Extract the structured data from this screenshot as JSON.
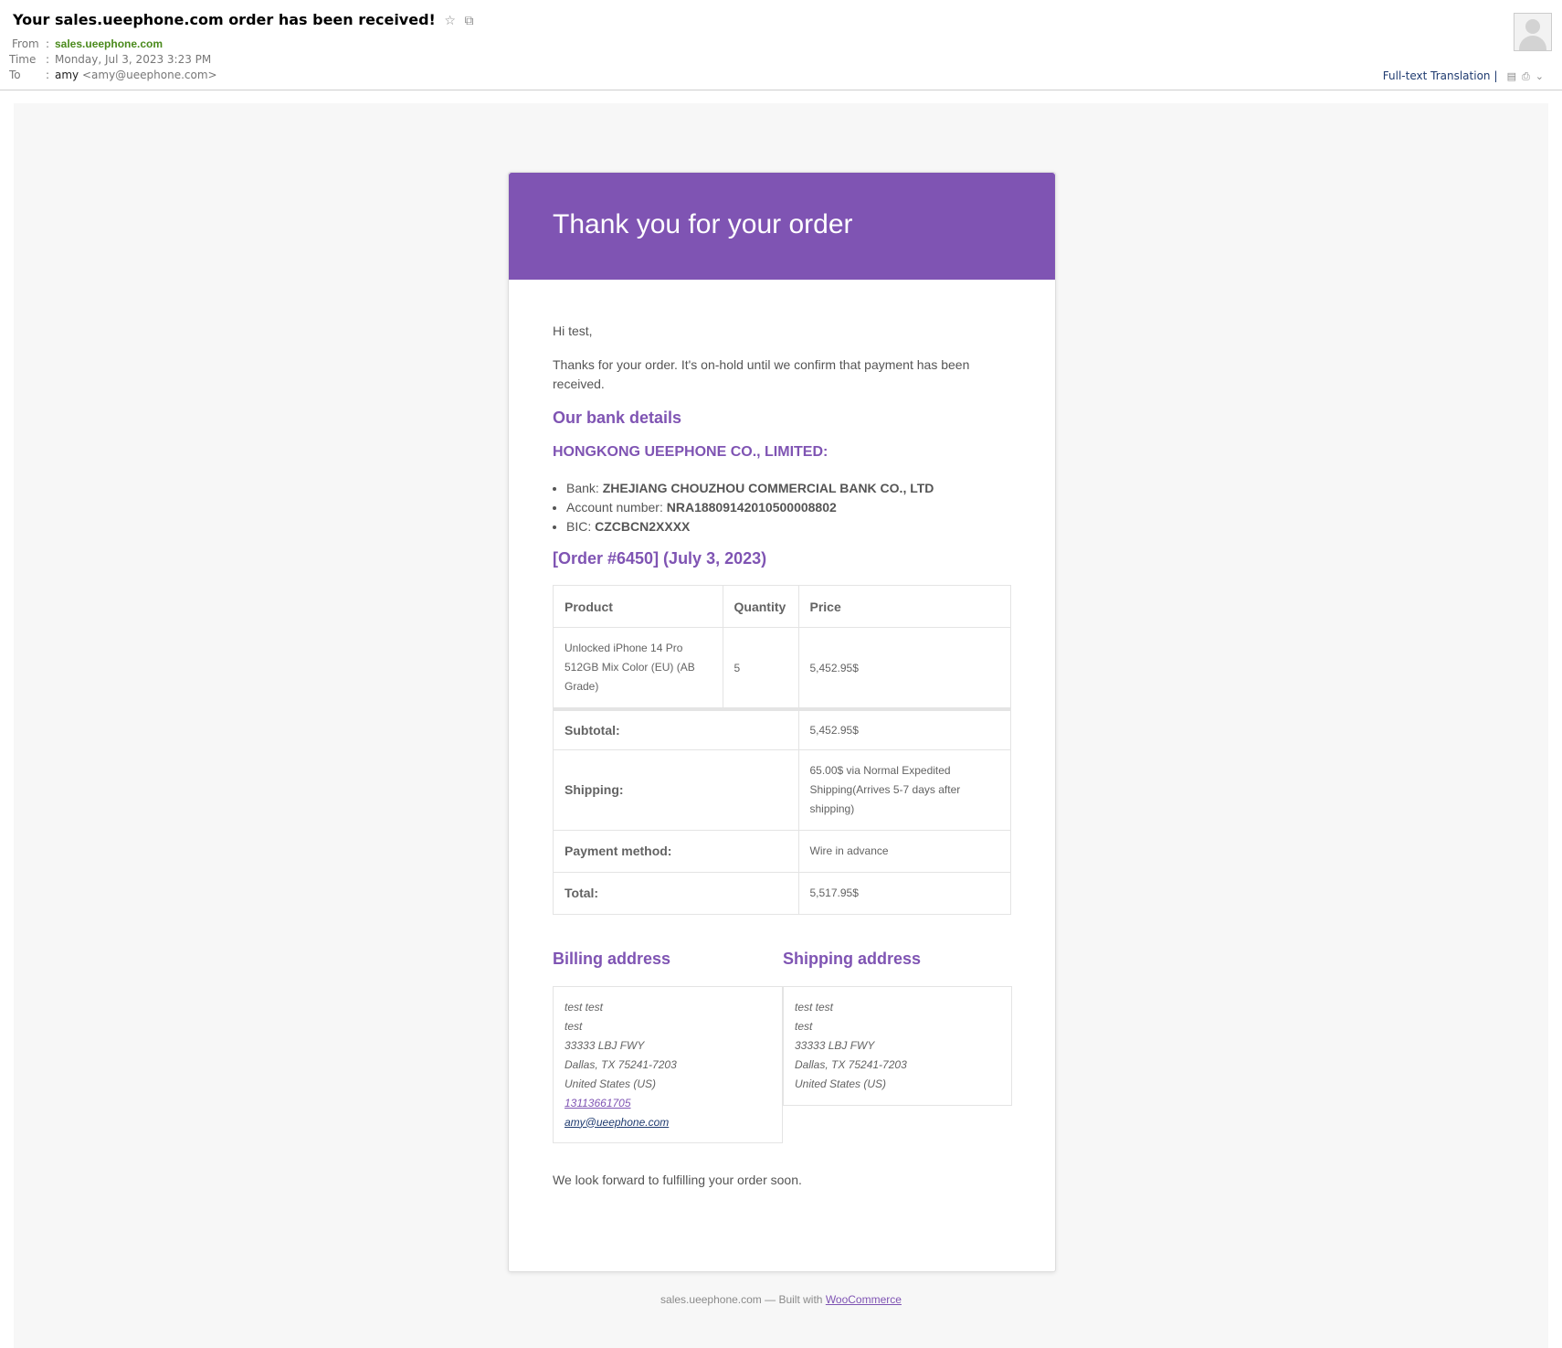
{
  "email": {
    "subject": "Your sales.ueephone.com order has been received!",
    "from_label": "From",
    "from_value": "sales.ueephone.com",
    "time_label": "Time",
    "time_value": "Monday, Jul 3, 2023 3:23 PM",
    "to_label": "To",
    "to_name": "amy",
    "to_address": "<amy@ueephone.com>",
    "translate_label": "Full-text Translation"
  },
  "order_email": {
    "banner_title": "Thank you for your order",
    "greeting": "Hi test,",
    "intro": "Thanks for your order. It's on-hold until we confirm that payment has been received.",
    "bank_heading": "Our bank details",
    "company": "HONGKONG UEEPHONE CO., LIMITED:",
    "bank_items": [
      {
        "label": "Bank:",
        "value": "ZHEJIANG CHOUZHOU COMMERCIAL BANK CO., LTD"
      },
      {
        "label": "Account number:",
        "value": "NRA18809142010500008802"
      },
      {
        "label": "BIC:",
        "value": "CZCBCN2XXXX"
      }
    ],
    "order_heading": "[Order #6450] (July 3, 2023)",
    "table": {
      "headers": [
        "Product",
        "Quantity",
        "Price"
      ],
      "items": [
        {
          "product": "Unlocked iPhone 14 Pro 512GB Mix Color (EU) (AB Grade)",
          "quantity": "5",
          "price": "5,452.95$"
        }
      ],
      "totals": [
        {
          "label": "Subtotal:",
          "value": "5,452.95$"
        },
        {
          "label": "Shipping:",
          "value": "65.00$ via Normal Expedited Shipping(Arrives 5-7 days after shipping)"
        },
        {
          "label": "Payment method:",
          "value": "Wire in advance"
        },
        {
          "label": "Total:",
          "value": "5,517.95$"
        }
      ]
    },
    "billing_heading": "Billing address",
    "shipping_heading": "Shipping address",
    "billing": {
      "name": "test test",
      "company": "test",
      "street": "33333 LBJ FWY",
      "city": "Dallas, TX 75241-7203",
      "country": "United States (US)",
      "phone": "13113661705",
      "email": "amy@ueephone.com"
    },
    "shipping": {
      "name": "test test",
      "company": "test",
      "street": "33333 LBJ FWY",
      "city": "Dallas, TX 75241-7203",
      "country": "United States (US)"
    },
    "closing": "We look forward to fulfilling your order soon."
  },
  "footer": {
    "site": "sales.ueephone.com — Built with ",
    "link": "WooCommerce"
  },
  "colors": {
    "brand_purple": "#7f54b3",
    "from_green": "#4a8a1c",
    "canvas_grey": "#f7f7f7"
  }
}
